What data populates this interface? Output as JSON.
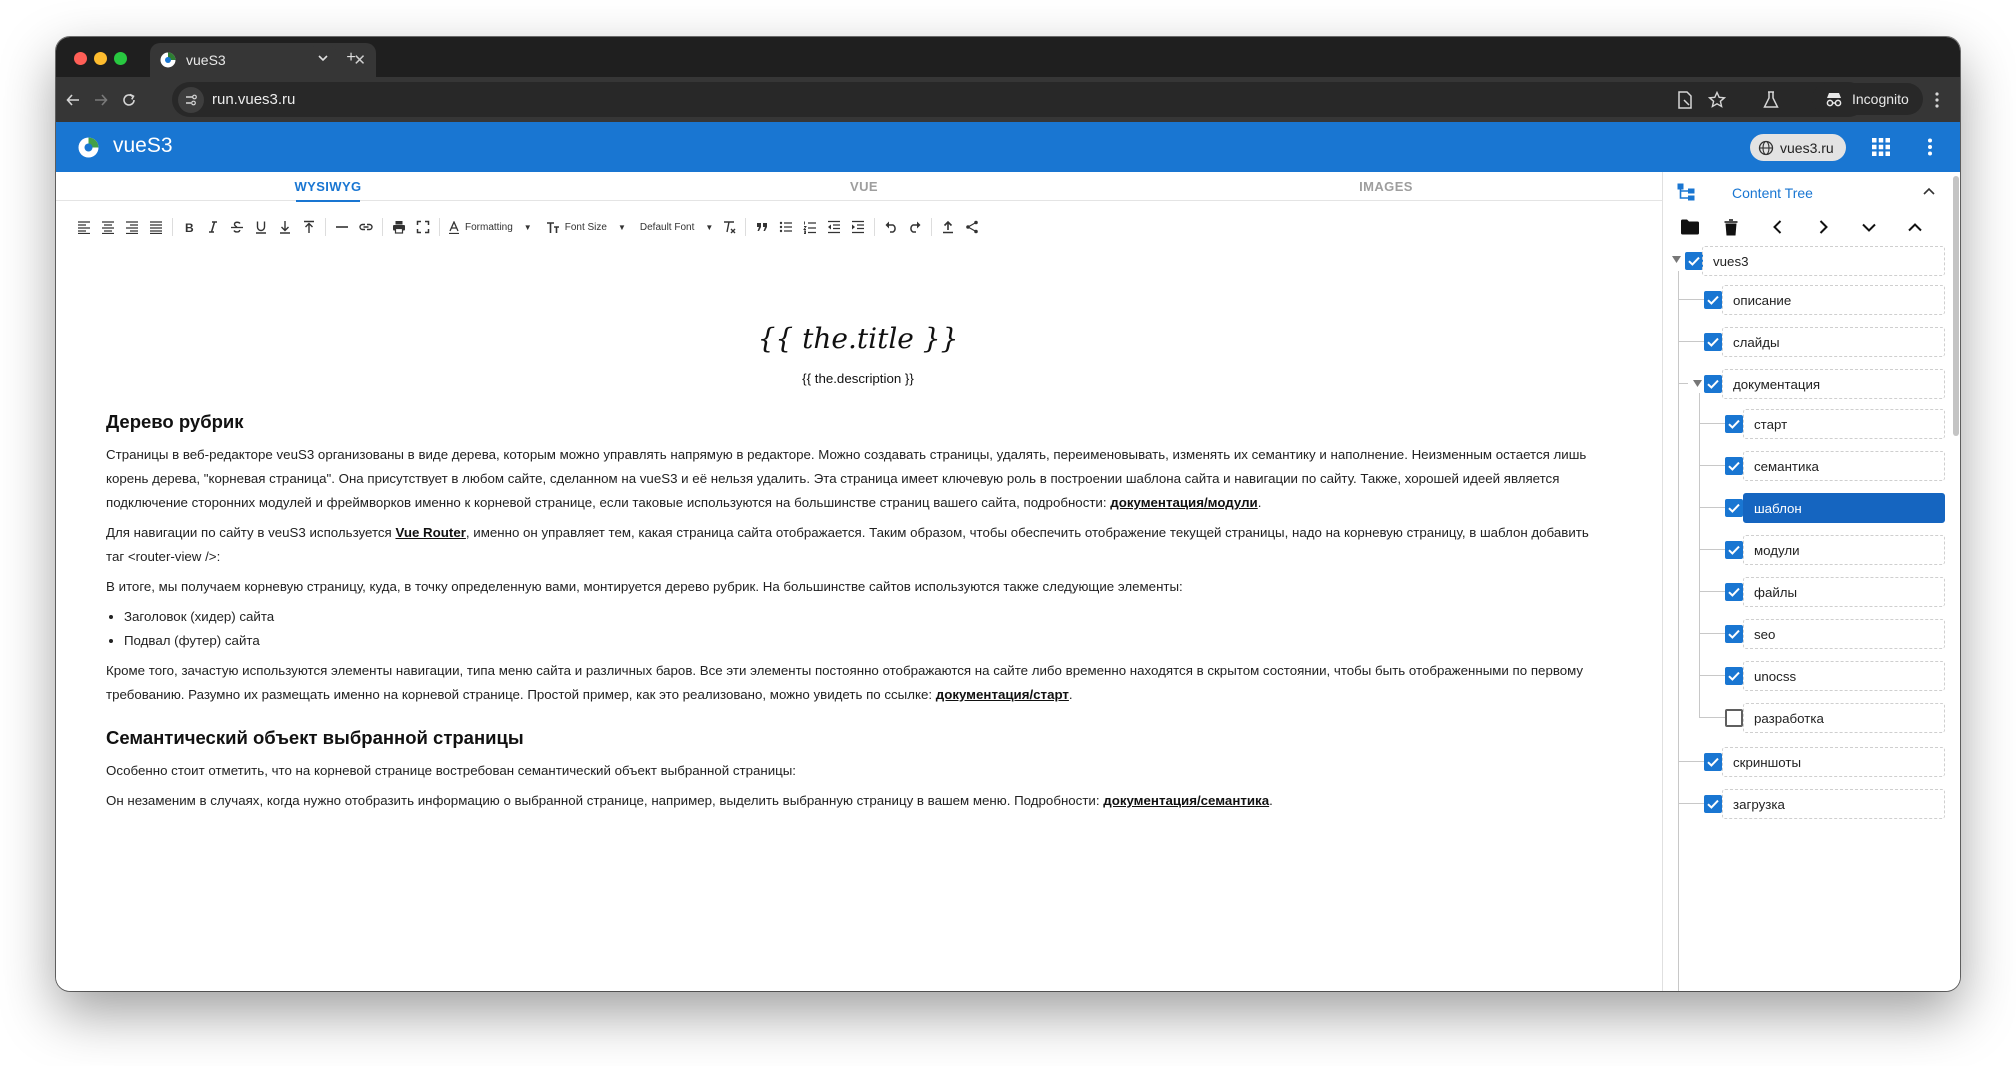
{
  "browser": {
    "tab_title": "vueS3",
    "url": "run.vues3.ru",
    "incognito_label": "Incognito"
  },
  "app": {
    "title": "vueS3",
    "domain_chip": "vues3.ru"
  },
  "editor": {
    "tabs": [
      "WYSIWYG",
      "VUE",
      "IMAGES"
    ],
    "active_tab": "WYSIWYG",
    "toolbar": {
      "formatting": "Formatting",
      "font_size": "Font Size",
      "default_font": "Default Font"
    }
  },
  "document": {
    "template_title": "{{ the.title }}",
    "template_description": "{{ the.description }}",
    "h_tree": "Дерево рубрик",
    "p1_text": "Страницы в веб-редакторе veuS3 организованы в виде дерева, которым можно управлять напрямую в редакторе. Можно создавать страницы, удалять, переименовывать, изменять их семантику и наполнение. Неизменным остается лишь корень дерева, \"корневая страница\". Она присутствует в любом сайте, сделанном на vueS3 и её нельзя удалить. Эта страница имеет ключевую роль в построении шаблона сайта и навигации по сайту. Также, хорошей идеей является подключение сторонних модулей и фреймворков именно к корневой странице, если таковые используются на большинстве страниц вашего сайта, подробности: ",
    "p1_link": "документация/модули",
    "p2_before": "Для навигации по сайту в veuS3 используется ",
    "p2_link": "Vue Router",
    "p2_after": ", именно он управляет тем, какая страница сайта отображается. Таким образом, чтобы обеспечить отображение текущей страницы, надо на корневую страницу, в шаблон добавить таг <router-view />:",
    "p3_text": "В итоге, мы получаем корневую страницу, куда, в точку определенную вами, монтируется дерево рубрик. На большинстве сайтов используются также следующие элементы:",
    "list_items": [
      "Заголовок (хидер) сайта",
      "Подвал (футер) сайта"
    ],
    "p4_text": "Кроме того, зачастую используются элементы навигации, типа меню сайта и различных баров. Все эти элементы постоянно отображаются на сайте либо временно находятся в скрытом состоянии, чтобы быть отображенными по первому требованию. Разумно их размещать именно на корневой странице. Простой пример, как это реализовано, можно увидеть по ссылке: ",
    "p4_link": "документация/старт",
    "h_semantic": "Семантический объект выбранной страницы",
    "p5_text": "Особенно стоит отметить, что на корневой странице востребован семантический объект выбранной страницы:",
    "p6_text": "Он незаменим в случаях, когда нужно отобразить информацию о выбранной странице, например, выделить выбранную страницу в вашем меню. Подробности: ",
    "p6_link": "документация/семантика"
  },
  "tree": {
    "title": "Content Tree",
    "nodes": [
      {
        "label": "vues3",
        "level": 0,
        "checked": true,
        "selected": false
      },
      {
        "label": "описание",
        "level": 1,
        "checked": true,
        "selected": false
      },
      {
        "label": "слайды",
        "level": 1,
        "checked": true,
        "selected": false
      },
      {
        "label": "документация",
        "level": 1,
        "checked": true,
        "selected": false
      },
      {
        "label": "старт",
        "level": 2,
        "checked": true,
        "selected": false
      },
      {
        "label": "семантика",
        "level": 2,
        "checked": true,
        "selected": false
      },
      {
        "label": "шаблон",
        "level": 2,
        "checked": true,
        "selected": true
      },
      {
        "label": "модули",
        "level": 2,
        "checked": true,
        "selected": false
      },
      {
        "label": "файлы",
        "level": 2,
        "checked": true,
        "selected": false
      },
      {
        "label": "seo",
        "level": 2,
        "checked": true,
        "selected": false
      },
      {
        "label": "unocss",
        "level": 2,
        "checked": true,
        "selected": false
      },
      {
        "label": "разработка",
        "level": 2,
        "checked": false,
        "selected": false
      },
      {
        "label": "скриншоты",
        "level": 1,
        "checked": true,
        "selected": false
      },
      {
        "label": "загрузка",
        "level": 1,
        "checked": true,
        "selected": false
      }
    ]
  },
  "colors": {
    "accent": "#1976d2",
    "selected_node": "#1565c0",
    "chrome_dark": "#1f1f1f",
    "chrome_toolbar": "#363636"
  }
}
